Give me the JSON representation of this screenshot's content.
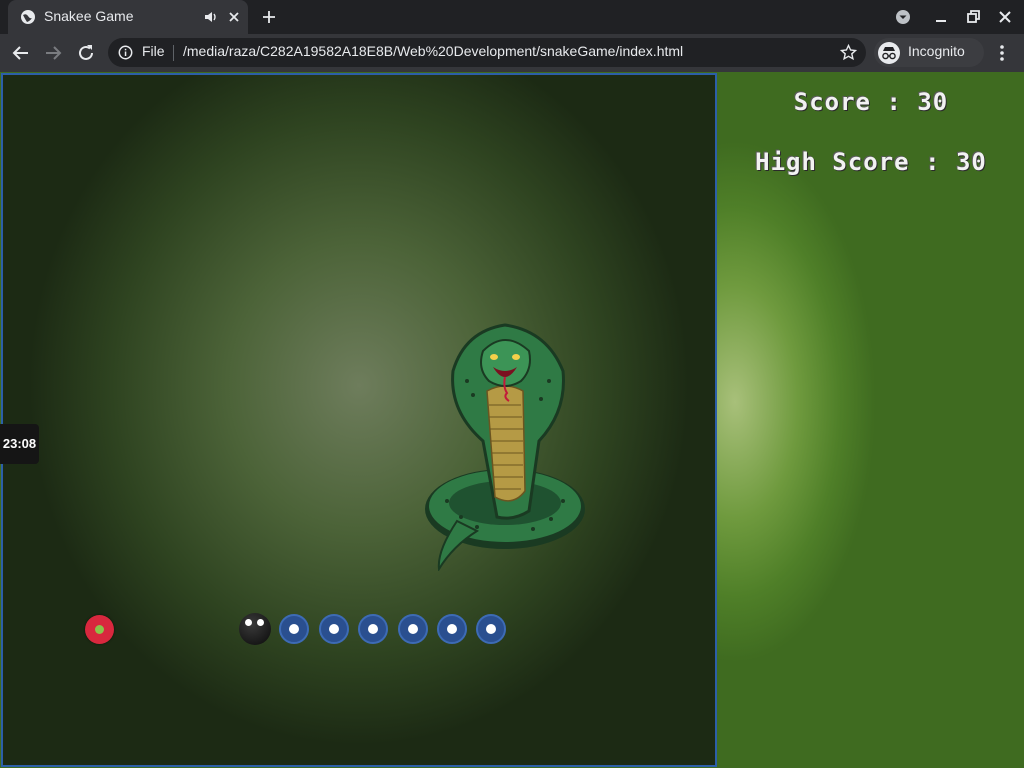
{
  "browser": {
    "tab_title": "Snakee Game",
    "url_scheme_label": "File",
    "url": "/media/raza/C282A19582A18E8B/Web%20Development/snakeGame/index.html",
    "profile_label": "Incognito"
  },
  "game": {
    "score_label": "Score : ",
    "score_value": "30",
    "high_score_label": "High Score : ",
    "high_score_value": "30",
    "time": "23:08",
    "snake_body_segments": 6,
    "colors": {
      "board_border": "#2c5fa8",
      "food": "#d8283e",
      "snake_head": "#111111",
      "snake_body": "#2a4f8f"
    }
  }
}
